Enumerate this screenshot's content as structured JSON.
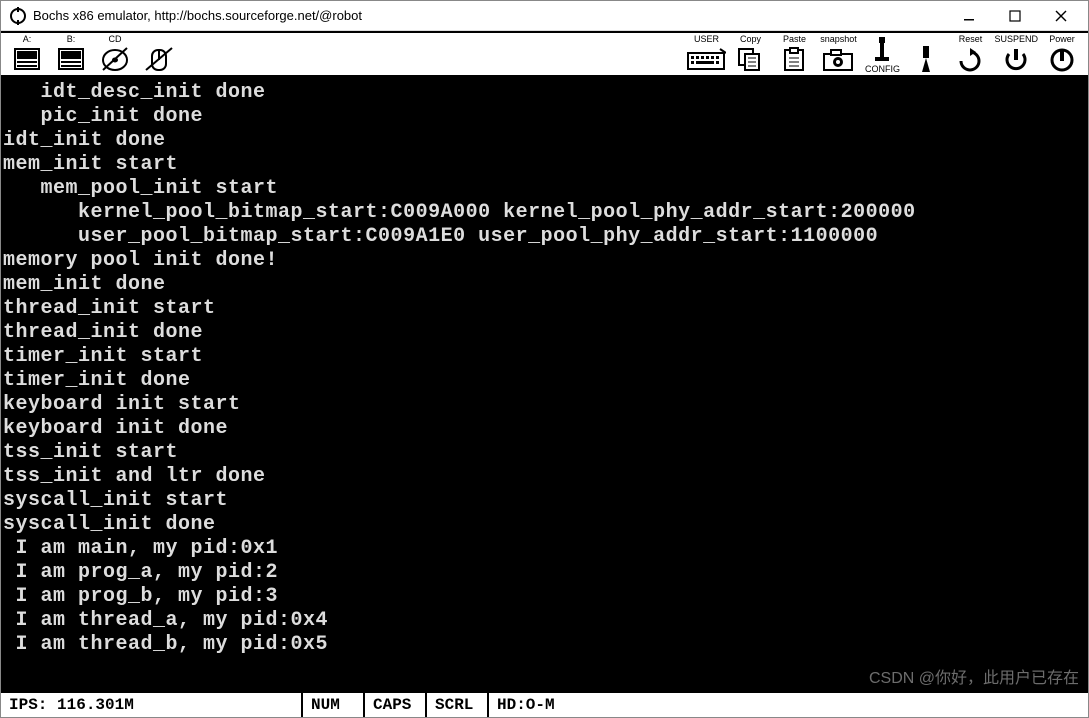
{
  "window": {
    "title": "Bochs x86 emulator, http://bochs.sourceforge.net/@robot"
  },
  "toolbar": {
    "drive_a": "A:",
    "drive_b": "B:",
    "drive_cd": "CD",
    "user": "USER",
    "copy": "Copy",
    "paste": "Paste",
    "snapshot": "snapshot",
    "config": "CONFIG",
    "reset": "Reset",
    "suspend": "SUSPEND",
    "power": "Power"
  },
  "terminal_lines": [
    "   idt_desc_init done",
    "   pic_init done",
    "idt_init done",
    "mem_init start",
    "   mem_pool_init start",
    "      kernel_pool_bitmap_start:C009A000 kernel_pool_phy_addr_start:200000",
    "      user_pool_bitmap_start:C009A1E0 user_pool_phy_addr_start:1100000",
    "memory pool init done!",
    "mem_init done",
    "thread_init start",
    "thread_init done",
    "timer_init start",
    "timer_init done",
    "keyboard init start",
    "keyboard init done",
    "tss_init start",
    "tss_init and ltr done",
    "syscall_init start",
    "syscall_init done",
    " I am main, my pid:0x1",
    " I am prog_a, my pid:2",
    " I am prog_b, my pid:3",
    " I am thread_a, my pid:0x4",
    " I am thread_b, my pid:0x5"
  ],
  "status": {
    "ips": "IPS: 116.301M",
    "num": "NUM",
    "caps": "CAPS",
    "scrl": "SCRL",
    "hd": "HD:O-M"
  },
  "watermark": "CSDN @你好，此用户已存在"
}
